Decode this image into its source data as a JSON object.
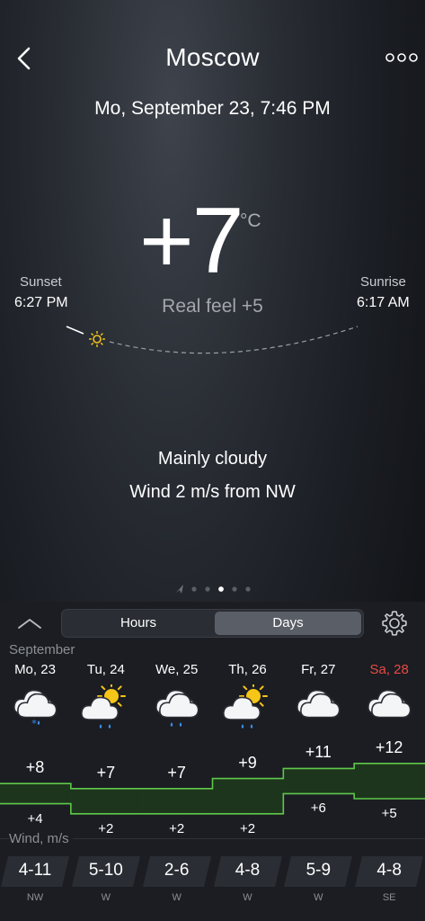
{
  "header": {
    "city": "Moscow",
    "datetime": "Mo, September 23, 7:46 PM"
  },
  "current": {
    "temperature": "+7",
    "unit": "°C",
    "real_feel": "Real feel +5",
    "condition": "Mainly cloudy",
    "wind": "Wind 2 m/s from NW"
  },
  "sun": {
    "sunset_label": "Sunset",
    "sunset_time": "6:27 PM",
    "sunrise_label": "Sunrise",
    "sunrise_time": "6:17 AM"
  },
  "pager": {
    "count": 6,
    "active": 3
  },
  "toggle": {
    "hours": "Hours",
    "days": "Days",
    "selected": "Days"
  },
  "forecast": {
    "month": "September",
    "wind_label": "Wind, m/s",
    "days": [
      {
        "name": "Mo, 23",
        "icon": "cloud-snow-icon",
        "high": "+8",
        "low": "+4",
        "wind": "4-11",
        "dir": "NW",
        "weekend": false
      },
      {
        "name": "Tu, 24",
        "icon": "sun-cloud-rain-icon",
        "high": "+7",
        "low": "+2",
        "wind": "5-10",
        "dir": "W",
        "weekend": false
      },
      {
        "name": "We, 25",
        "icon": "cloud-rain-icon",
        "high": "+7",
        "low": "+2",
        "wind": "2-6",
        "dir": "W",
        "weekend": false
      },
      {
        "name": "Th, 26",
        "icon": "sun-cloud-rain-icon",
        "high": "+9",
        "low": "+2",
        "wind": "4-8",
        "dir": "W",
        "weekend": false
      },
      {
        "name": "Fr, 27",
        "icon": "cloud-icon",
        "high": "+11",
        "low": "+6",
        "wind": "5-9",
        "dir": "W",
        "weekend": false
      },
      {
        "name": "Sa, 28",
        "icon": "cloud-icon",
        "high": "+12",
        "low": "+5",
        "wind": "4-8",
        "dir": "SE",
        "weekend": true
      }
    ]
  },
  "colors": {
    "accent_green": "#5fc84a",
    "weekend_red": "#e94a44",
    "sun_yellow": "#f5c518",
    "rain_blue": "#3d8ef0"
  }
}
